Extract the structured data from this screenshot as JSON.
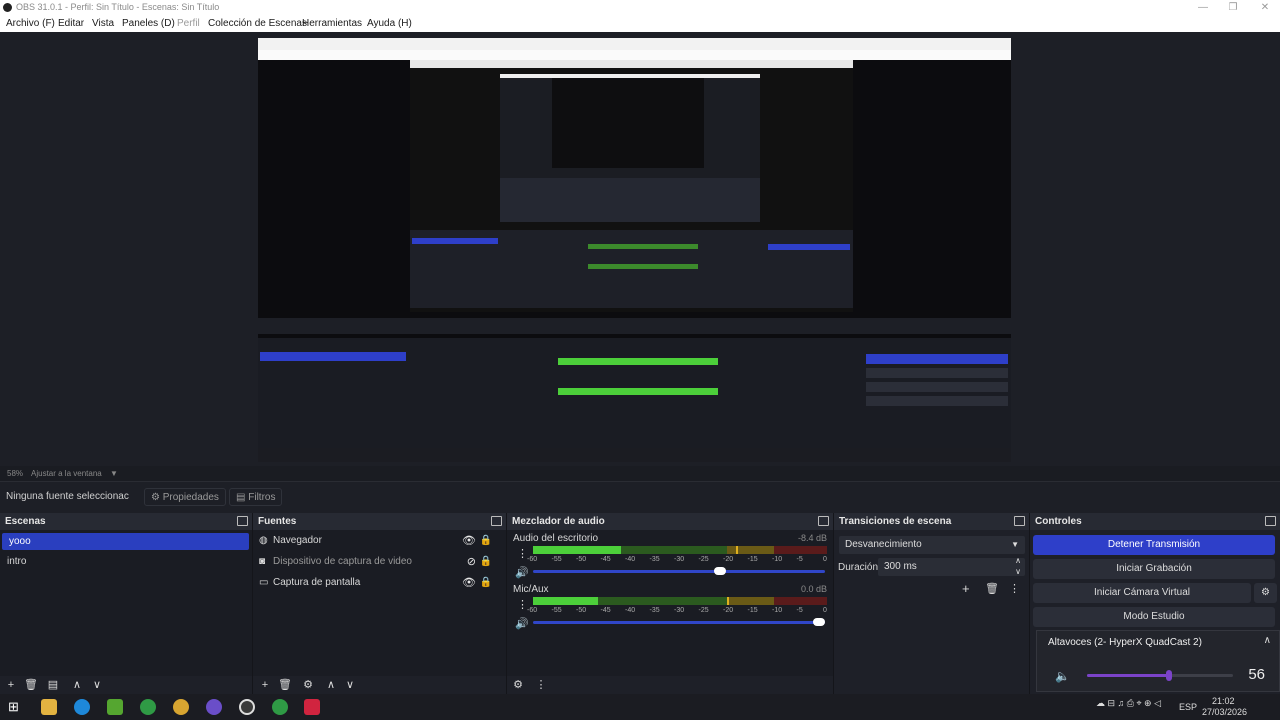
{
  "window": {
    "title": "OBS 31.0.1 - Perfil: Sin Título - Escenas: Sin Título"
  },
  "menu": [
    "Archivo (F)",
    "Editar",
    "Vista",
    "Paneles (D)",
    "Perfil",
    "Colección de Escenas",
    "Herramientas",
    "Ayuda (H)"
  ],
  "preview": {
    "zoom": "58%",
    "fit_label": "Ajustar a la ventana"
  },
  "source_bar": {
    "no_selection": "Ninguna fuente seleccionac",
    "properties": "Propiedades",
    "filters": "Filtros"
  },
  "scenes": {
    "title": "Escenas",
    "items": [
      "yooo",
      "intro"
    ],
    "selected": 0
  },
  "sources": {
    "title": "Fuentes",
    "items": [
      {
        "label": "Navegador",
        "icon": "globe-icon",
        "visible": true
      },
      {
        "label": "Dispositivo de captura de video",
        "icon": "camera-icon",
        "visible": false
      },
      {
        "label": "Captura de pantalla",
        "icon": "monitor-icon",
        "visible": true
      }
    ]
  },
  "mixer": {
    "title": "Mezclador de audio",
    "channels": [
      {
        "name": "Audio del escritorio",
        "db": "-8.4 dB",
        "level": 0.3,
        "peak": 0.69,
        "volume": 0.66
      },
      {
        "name": "Mic/Aux",
        "db": "0.0 dB",
        "level": 0.22,
        "peak": 0.66,
        "volume": 1.0
      }
    ],
    "ticks": [
      "-60",
      "-55",
      "-50",
      "-45",
      "-40",
      "-35",
      "-30",
      "-25",
      "-20",
      "-15",
      "-10",
      "-5",
      "0"
    ]
  },
  "transitions": {
    "title": "Transiciones de escena",
    "selected": "Desvanecimiento",
    "duration_label": "Duración",
    "duration_value": "300 ms"
  },
  "controls": {
    "title": "Controles",
    "stop_stream": "Detener Transmisión",
    "start_recording": "Iniciar Grabación",
    "start_virtual_cam": "Iniciar Cámara Virtual",
    "studio_mode": "Modo Estudio"
  },
  "volume_popup": {
    "device": "Altavoces (2- HyperX QuadCast 2)",
    "value": "56",
    "level": 0.56
  },
  "taskbar": {
    "lang": "ESP",
    "time": "21:02",
    "date": "27/03/2026"
  },
  "colors": {
    "accent": "#2e3fc9",
    "popup_slider": "#7b43c9"
  }
}
